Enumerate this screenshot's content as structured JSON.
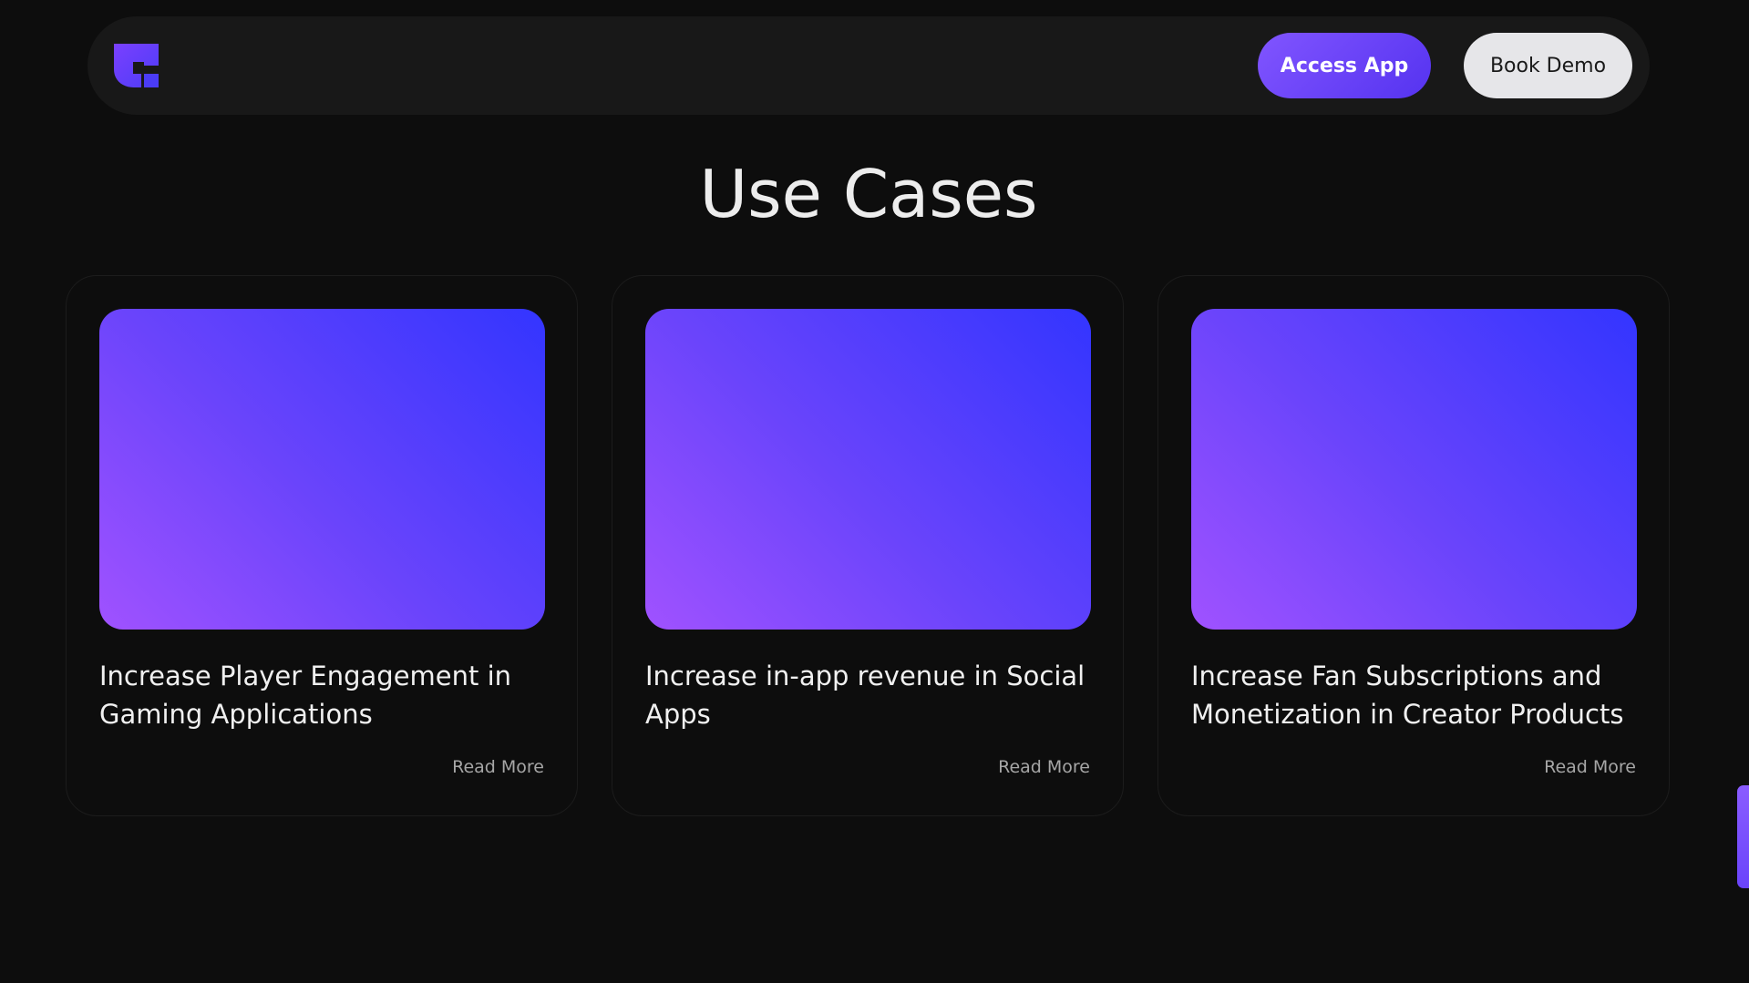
{
  "header": {
    "logo_icon": "brand-logo-icon",
    "access_label": "Access App",
    "demo_label": "Book Demo"
  },
  "section": {
    "title": "Use Cases"
  },
  "cards": [
    {
      "title": "Increase Player Engagement in Gaming Applications",
      "link": "Read More"
    },
    {
      "title": "Increase in-app revenue in Social Apps",
      "link": "Read More"
    },
    {
      "title": "Increase Fan Subscriptions and Monetization in Creator Products",
      "link": "Read More"
    }
  ],
  "colors": {
    "background": "#0d0d0d",
    "navbar": "#181818",
    "accent": "#6a44fb",
    "gradient_start": "#a052ff",
    "gradient_end": "#3335ff"
  }
}
